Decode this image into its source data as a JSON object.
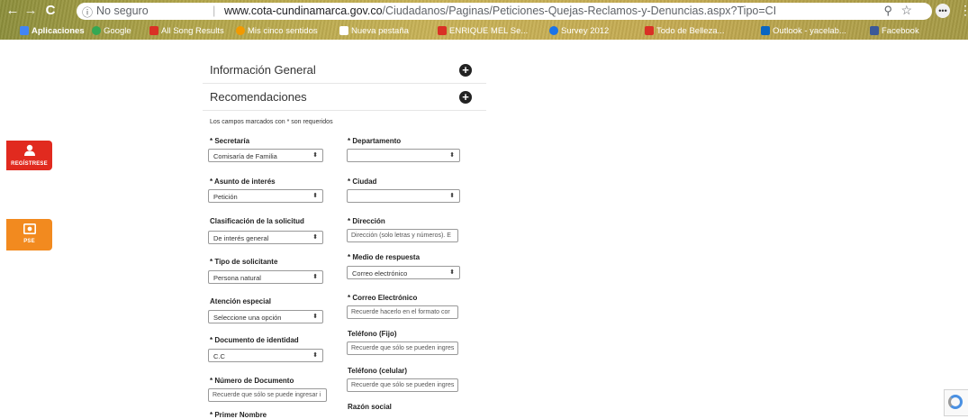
{
  "browser": {
    "security_label": "No seguro",
    "url_host": "www.cota-cundinamarca.gov.co",
    "url_path": "/Ciudadanos/Paginas/Peticiones-Quejas-Reclamos-y-Denuncias.aspx?Tipo=CI",
    "bookmarks": [
      {
        "label": "Aplicaciones",
        "color": "#4285f4"
      },
      {
        "label": "Google",
        "color": "#34a853"
      },
      {
        "label": "All Song Results",
        "color": "#d93025"
      },
      {
        "label": "Mis cinco sentidos",
        "color": "#f29900"
      },
      {
        "label": "Nueva pestaña",
        "color": "#ffffff"
      },
      {
        "label": "ENRIQUE MEL Se...",
        "color": "#d93025"
      },
      {
        "label": "Survey 2012",
        "color": "#1a73e8"
      },
      {
        "label": "Todo de Belleza...",
        "color": "#d93025"
      },
      {
        "label": "Outlook - yacelab...",
        "color": "#0a66c2"
      },
      {
        "label": "Facebook",
        "color": "#3b5998"
      }
    ]
  },
  "side": {
    "register_label": "REGÍSTRESE",
    "pse_label": "PSE",
    "register_color": "#e12a1f",
    "pse_color": "#f28a1f"
  },
  "sections": {
    "general": "Información General",
    "recommendations": "Recomendaciones"
  },
  "form": {
    "note": "Los campos marcados con * son requeridos",
    "secretaria": {
      "label": "* Secretaría",
      "value": "Comisaría de Familia"
    },
    "departamento": {
      "label": "* Departamento",
      "value": ""
    },
    "asunto": {
      "label": "* Asunto de interés",
      "value": "Petición"
    },
    "ciudad": {
      "label": "* Ciudad",
      "value": ""
    },
    "clasificacion": {
      "label": "Clasificación de la solicitud",
      "value": "De interés general"
    },
    "direccion": {
      "label": "* Dirección",
      "placeholder": "Dirección (solo letras y números). E"
    },
    "tipo_solicitante": {
      "label": "* Tipo de solicitante",
      "value": "Persona natural"
    },
    "medio_respuesta": {
      "label": "* Medio de respuesta",
      "value": "Correo electrónico"
    },
    "atencion": {
      "label": "Atención especial",
      "value": "Seleccione una opción"
    },
    "correo": {
      "label": "* Correo Electrónico",
      "placeholder": "Recuerde hacerlo en el formato cor"
    },
    "documento": {
      "label": "* Documento de identidad",
      "value": "C.C"
    },
    "tel_fijo": {
      "label": "Teléfono (Fijo)",
      "placeholder": "Recuerde que sólo se pueden ingres"
    },
    "tel_celular": {
      "label": "Teléfono (celular)",
      "placeholder": "Recuerde que sólo se pueden ingres"
    },
    "numero_doc": {
      "label": "* Número de Documento",
      "placeholder": "Recuerde que sólo se puede ingresar i"
    },
    "razon_social": {
      "label": "Razón social"
    },
    "primer_nombre": {
      "label": "* Primer Nombre"
    }
  }
}
